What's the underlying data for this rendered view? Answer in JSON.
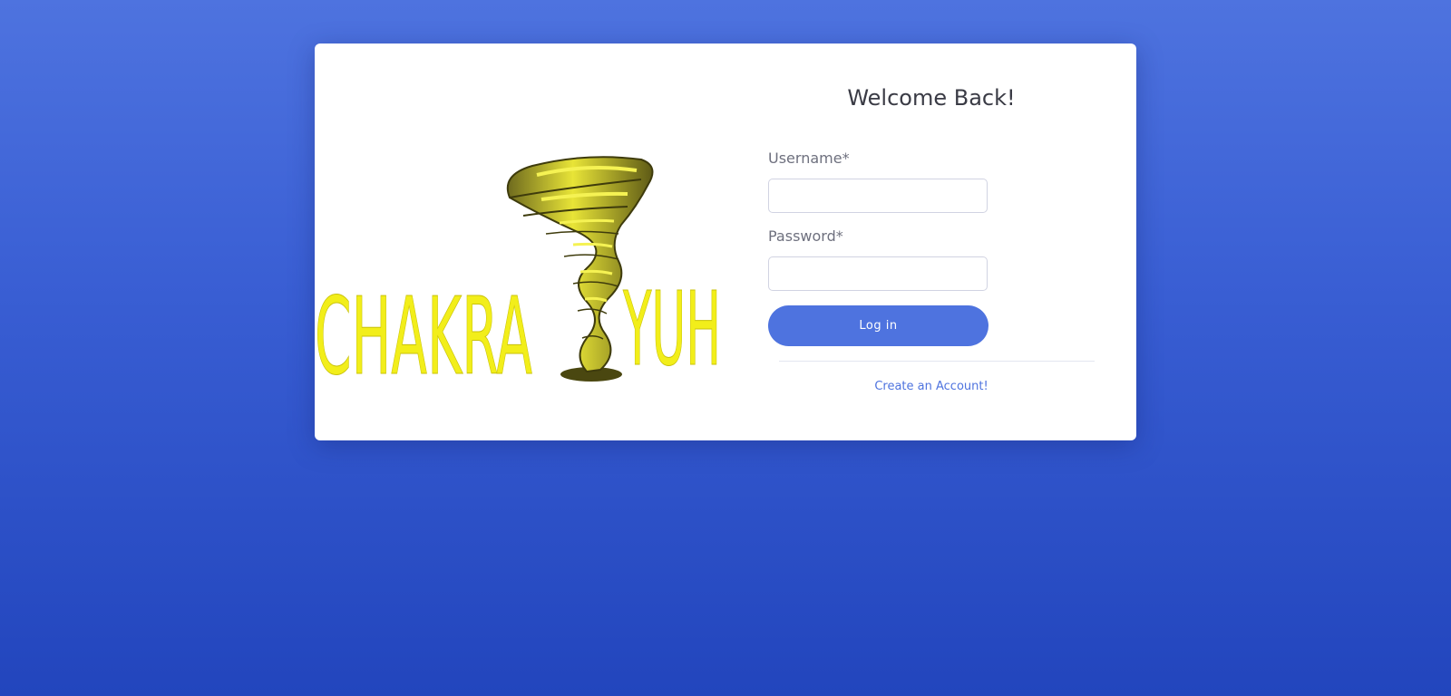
{
  "logo": {
    "text_left": "CHAKRA",
    "text_right": "YUH"
  },
  "form": {
    "title": "Welcome Back!",
    "username_label": "Username*",
    "username_value": "",
    "password_label": "Password*",
    "password_value": "",
    "login_label": "Log in",
    "create_account_label": "Create an Account!"
  },
  "colors": {
    "background_top": "#4e73df",
    "background_bottom": "#2245bd",
    "accent": "#4e73df",
    "logo_yellow": "#f2ee1a"
  }
}
